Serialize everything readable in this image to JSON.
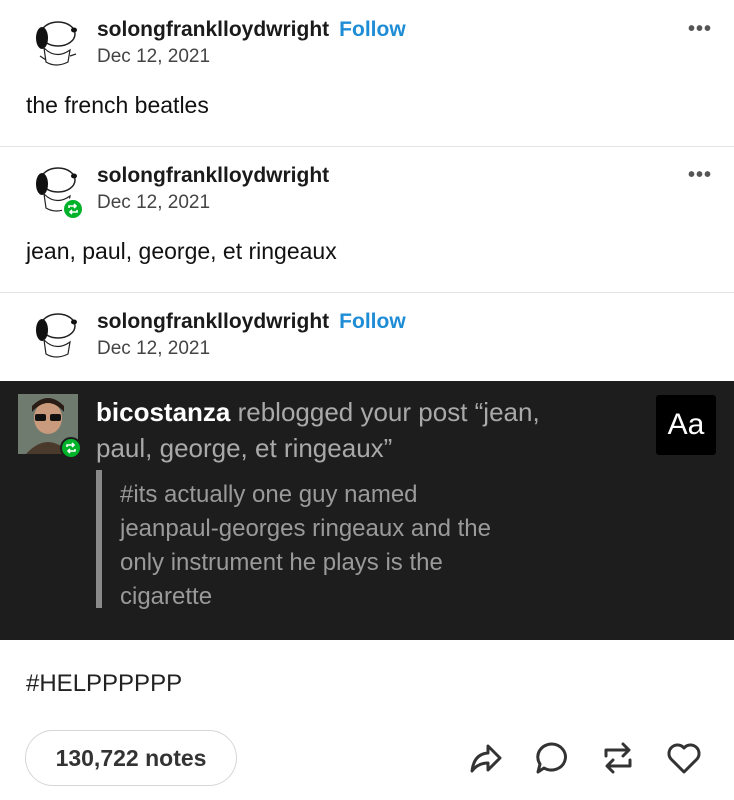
{
  "posts": [
    {
      "username": "solongfranklloydwright",
      "follow_label": "Follow",
      "date": "Dec 12, 2021",
      "body": "the french beatles",
      "more_label": "•••"
    },
    {
      "username": "solongfranklloydwright",
      "date": "Dec 12, 2021",
      "body": "jean, paul, george, et ringeaux",
      "more_label": "•••"
    },
    {
      "username": "solongfranklloydwright",
      "follow_label": "Follow",
      "date": "Dec 12, 2021"
    }
  ],
  "screenshot": {
    "reblogger": "bicostanza",
    "line1_rest": " reblogged your post “jean,",
    "line2": "paul, george, et ringeaux”",
    "aa_label": "Aa",
    "tags": [
      "#its actually one guy named",
      "jeanpaul-georges ringeaux and the",
      "only instrument he plays is the",
      "cigarette"
    ]
  },
  "hashtag": "#HELPPPPPP",
  "notes": "130,722 notes",
  "colors": {
    "follow": "#1f8dd6",
    "reblog_green": "#00b12a",
    "dark_bg": "#1d1d1d"
  },
  "icons": [
    "share-icon",
    "reply-icon",
    "reblog-icon",
    "like-icon"
  ]
}
